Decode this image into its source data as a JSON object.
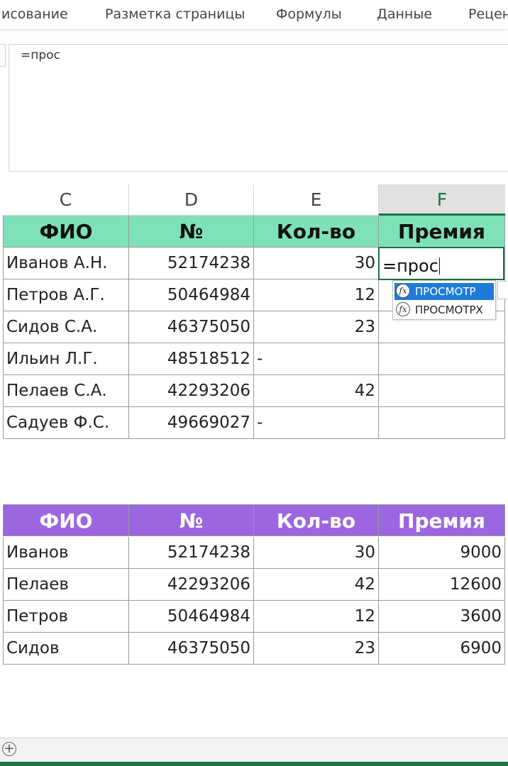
{
  "ribbon": {
    "tabs": [
      "исование",
      "Разметка страницы",
      "Формулы",
      "Данные",
      "Рецен"
    ]
  },
  "formula_bar": {
    "value": "=прос"
  },
  "columns": [
    "C",
    "D",
    "E",
    "F"
  ],
  "selected_column": "F",
  "table1": {
    "headers": [
      "ФИО",
      "№",
      "Кол-во",
      "Премия"
    ],
    "header_color": "#7ee1b8",
    "rows": [
      [
        "Иванов А.Н.",
        "52174238",
        "30",
        ""
      ],
      [
        "Петров А.Г.",
        "50464984",
        "12",
        ""
      ],
      [
        "Сидов С.А.",
        "46375050",
        "23",
        ""
      ],
      [
        "Ильин Л.Г.",
        "48518512",
        "-",
        ""
      ],
      [
        "Пелаев С.А.",
        "42293206",
        "42",
        ""
      ],
      [
        "Садуев Ф.С.",
        "49669027",
        "-",
        ""
      ]
    ]
  },
  "active_cell": {
    "column": "F",
    "value": "=прос"
  },
  "autocomplete": {
    "icon": "function-icon",
    "items": [
      "ПРОСМОТР",
      "ПРОСМОТРX"
    ],
    "selected_index": 0
  },
  "table2": {
    "headers": [
      "ФИО",
      "№",
      "Кол-во",
      "Премия"
    ],
    "header_color": "#9c66e0",
    "rows": [
      [
        "Иванов",
        "52174238",
        "30",
        "9000"
      ],
      [
        "Пелаев",
        "42293206",
        "42",
        "12600"
      ],
      [
        "Петров",
        "50464984",
        "12",
        "3600"
      ],
      [
        "Сидов",
        "46375050",
        "23",
        "6900"
      ]
    ]
  },
  "sheetbar": {
    "add_sheet_symbol": "+"
  },
  "accent_color": "#217346"
}
